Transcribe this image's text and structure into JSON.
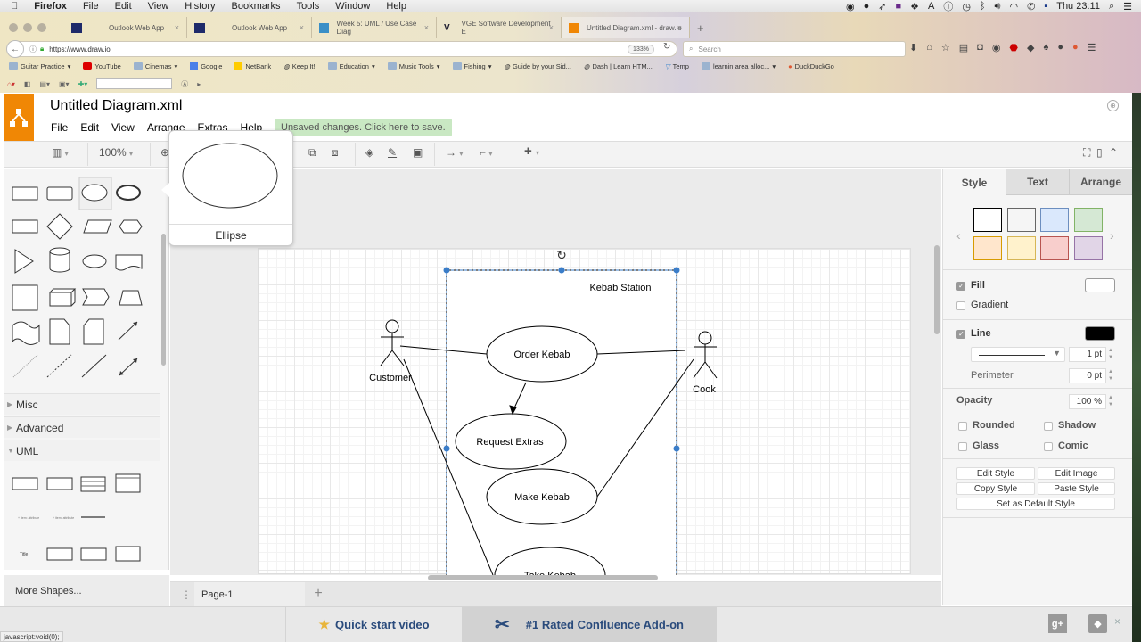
{
  "macos_menubar": {
    "app_name": "Firefox",
    "menus": [
      "File",
      "Edit",
      "View",
      "History",
      "Bookmarks",
      "Tools",
      "Window",
      "Help"
    ],
    "clock": "Thu 23:11"
  },
  "browser": {
    "tabs": [
      {
        "label": "Outlook Web App",
        "icon": "outlook-icon"
      },
      {
        "label": "Outlook Web App",
        "icon": "outlook-icon"
      },
      {
        "label": "Week 5: UML / Use Case Diag",
        "icon": "moodle-icon"
      },
      {
        "label": "VGE Software Development E",
        "icon": "vge-icon"
      },
      {
        "label": "Untitled Diagram.xml - draw.io",
        "icon": "drawio-icon",
        "active": true
      }
    ],
    "new_tab": "+",
    "url": "https://www.draw.io",
    "zoom": "133%",
    "search_placeholder": "Search",
    "bookmarks": [
      {
        "label": "Guitar Practice",
        "type": "folder"
      },
      {
        "label": "YouTube",
        "type": "link"
      },
      {
        "label": "Cinemas",
        "type": "folder"
      },
      {
        "label": "Google",
        "type": "link"
      },
      {
        "label": "NetBank",
        "type": "link"
      },
      {
        "label": "Keep It!",
        "type": "link"
      },
      {
        "label": "Education",
        "type": "folder"
      },
      {
        "label": "Music Tools",
        "type": "folder"
      },
      {
        "label": "Fishing",
        "type": "folder"
      },
      {
        "label": "Guide by your Sid...",
        "type": "link"
      },
      {
        "label": "Dash | Learn HTM...",
        "type": "link"
      },
      {
        "label": "Temp",
        "type": "link"
      },
      {
        "label": "learnin area alloc...",
        "type": "folder"
      },
      {
        "label": "DuckDuckGo",
        "type": "link"
      }
    ],
    "status_url": "javascript:void(0);"
  },
  "app": {
    "title": "Untitled Diagram.xml",
    "menus": [
      "File",
      "Edit",
      "View",
      "Arrange",
      "Extras",
      "Help"
    ],
    "unsaved_notice": "Unsaved changes. Click here to save.",
    "toolbar": {
      "zoom": "100%"
    },
    "shape_tooltip": {
      "label": "Ellipse"
    },
    "sidebar": {
      "sections": [
        {
          "label": "Misc",
          "expanded": false
        },
        {
          "label": "Advanced",
          "expanded": false
        },
        {
          "label": "UML",
          "expanded": true
        }
      ],
      "more_shapes": "More Shapes..."
    },
    "diagram": {
      "system_boundary": "Kebab Station",
      "actors": [
        "Customer",
        "Cook"
      ],
      "use_cases": [
        "Order Kebab",
        "Request Extras",
        "Make Kebab",
        "Take Kebab"
      ]
    },
    "pages": {
      "current": "Page-1",
      "add": "+"
    },
    "format_panel": {
      "tabs": [
        "Style",
        "Text",
        "Arrange"
      ],
      "active_tab": "Style",
      "swatches": [
        {
          "fill": "#ffffff",
          "stroke": "#000000"
        },
        {
          "fill": "#f5f5f5",
          "stroke": "#666666"
        },
        {
          "fill": "#dae8fc",
          "stroke": "#6c8ebf"
        },
        {
          "fill": "#d5e8d4",
          "stroke": "#82b366"
        },
        {
          "fill": "#ffe6cc",
          "stroke": "#d79b00"
        },
        {
          "fill": "#fff2cc",
          "stroke": "#d6b656"
        },
        {
          "fill": "#f8cecc",
          "stroke": "#b85450"
        },
        {
          "fill": "#e1d5e7",
          "stroke": "#9673a6"
        }
      ],
      "fill": {
        "label": "Fill",
        "checked": true,
        "color": "#ffffff"
      },
      "gradient": {
        "label": "Gradient",
        "checked": false
      },
      "line": {
        "label": "Line",
        "checked": true,
        "color": "#000000",
        "width": "1 pt"
      },
      "perimeter": {
        "label": "Perimeter",
        "value": "0 pt"
      },
      "opacity": {
        "label": "Opacity",
        "value": "100 %"
      },
      "options": [
        {
          "label": "Rounded",
          "checked": false
        },
        {
          "label": "Shadow",
          "checked": false
        },
        {
          "label": "Glass",
          "checked": false
        },
        {
          "label": "Comic",
          "checked": false
        }
      ],
      "buttons": {
        "edit_style": "Edit Style",
        "edit_image": "Edit Image",
        "copy_style": "Copy Style",
        "paste_style": "Paste Style",
        "set_default": "Set as Default Style"
      }
    },
    "footer": {
      "quick_start": "Quick start video",
      "confluence": "#1 Rated Confluence Add-on",
      "gplus": "g+",
      "close": "×"
    }
  }
}
